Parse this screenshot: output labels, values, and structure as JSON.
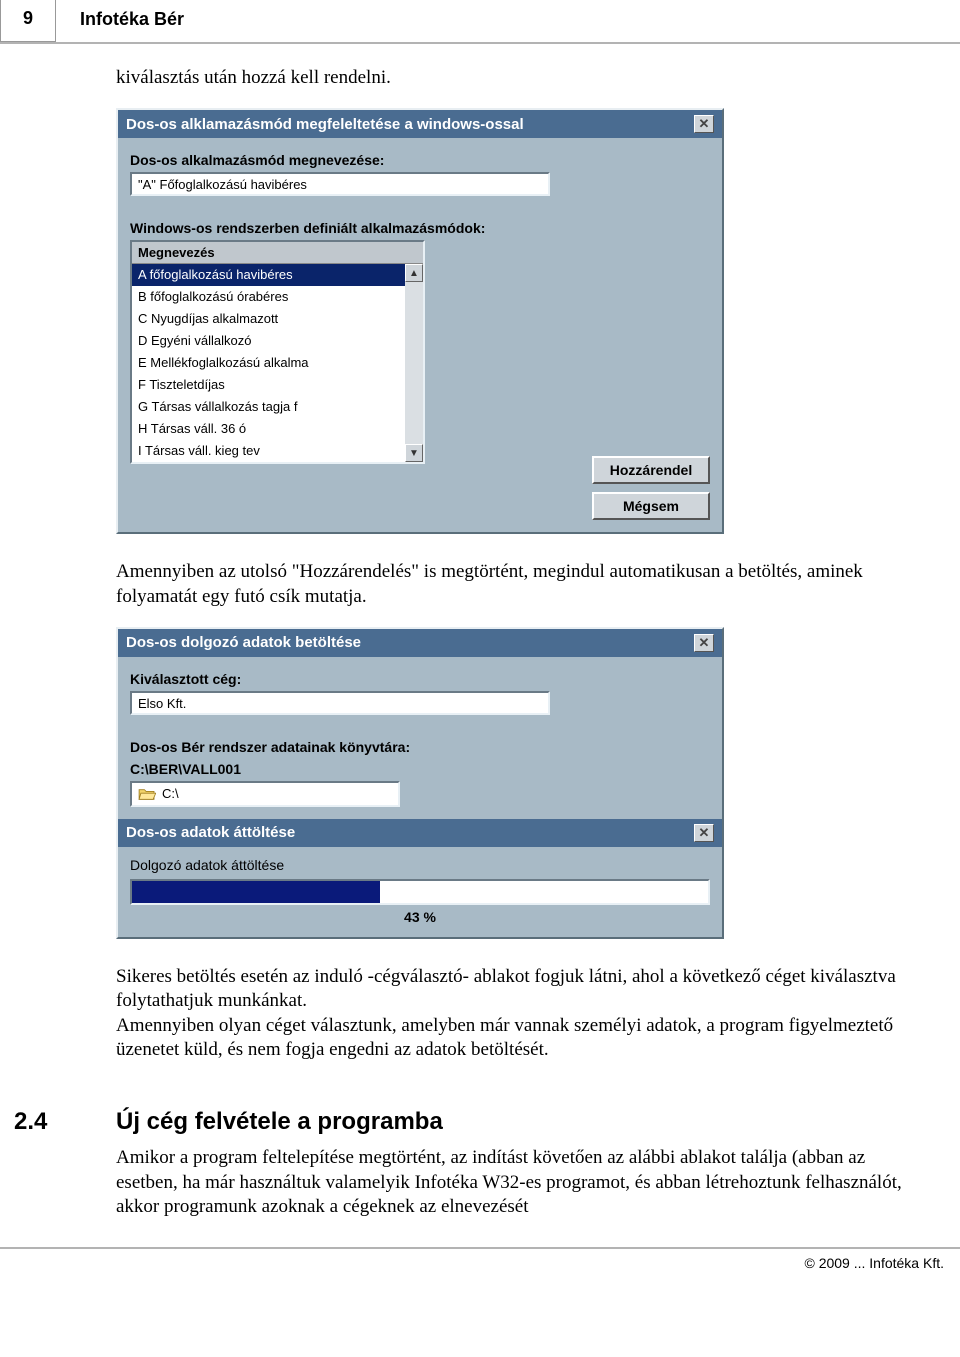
{
  "page": {
    "number": "9",
    "title": "Infotéka Bér",
    "footer": "© 2009 ... Infotéka Kft."
  },
  "paragraphs": {
    "p1": "kiválasztás után hozzá kell rendelni.",
    "p2": "Amennyiben az utolsó \"Hozzárendelés\" is megtörtént, megindul automatikusan a betöltés, aminek folyamatát egy futó csík mutatja.",
    "p3": "Sikeres betöltés esetén az induló -cégválasztó- ablakot fogjuk látni, ahol a következő céget kiválasztva folytathatjuk munkánkat.",
    "p4": "Amennyiben olyan céget választunk, amelyben már vannak személyi adatok, a program figyelmeztető üzenetet küld, és nem fogja engedni az adatok betöltését.",
    "p5": "Amikor a program feltelepítése megtörtént, az indítást követően az alábbi ablakot találja (abban az esetben, ha már használtuk valamelyik Infotéka W32-es programot, és abban létrehoztunk felhasználót, akkor programunk azoknak a cégeknek az elnevezését"
  },
  "section": {
    "num": "2.4",
    "title": "Új cég felvétele a programba"
  },
  "dialog1": {
    "title": "Dos-os alklamazásmód megfeleltetése a windows-ossal",
    "label1": "Dos-os alkalmazásmód megnevezése:",
    "input1": "\"A\" Főfoglalkozású havibéres",
    "label2": "Windows-os rendszerben definiált alkalmazásmódok:",
    "listHeader": "Megnevezés",
    "items": [
      "A főfoglalkozású havibéres",
      "B főfoglalkozású órabéres",
      "C Nyugdíjas alkalmazott",
      "D Egyéni vállalkozó",
      "E Mellékfoglalkozású alkalma",
      "F Tiszteletdíjas",
      "G Társas vállalkozás tagja f",
      "H Társas váll. 36 ó",
      "I Társas váll. kieg tev"
    ],
    "btnAssign": "Hozzárendel",
    "btnCancel": "Mégsem"
  },
  "dialog2": {
    "title": "Dos-os dolgozó adatok betöltése",
    "labelCompany": "Kiválasztott cég:",
    "company": "Elso Kft.",
    "labelDir": "Dos-os Bér rendszer adatainak könyvtára:",
    "dirPath": "C:\\BER\\VALL001",
    "folderPath": "C:\\"
  },
  "dialog3": {
    "title": "Dos-os adatok áttöltése",
    "status": "Dolgozó adatok áttöltése",
    "percentLabel": "43 %",
    "percentValue": 43
  }
}
